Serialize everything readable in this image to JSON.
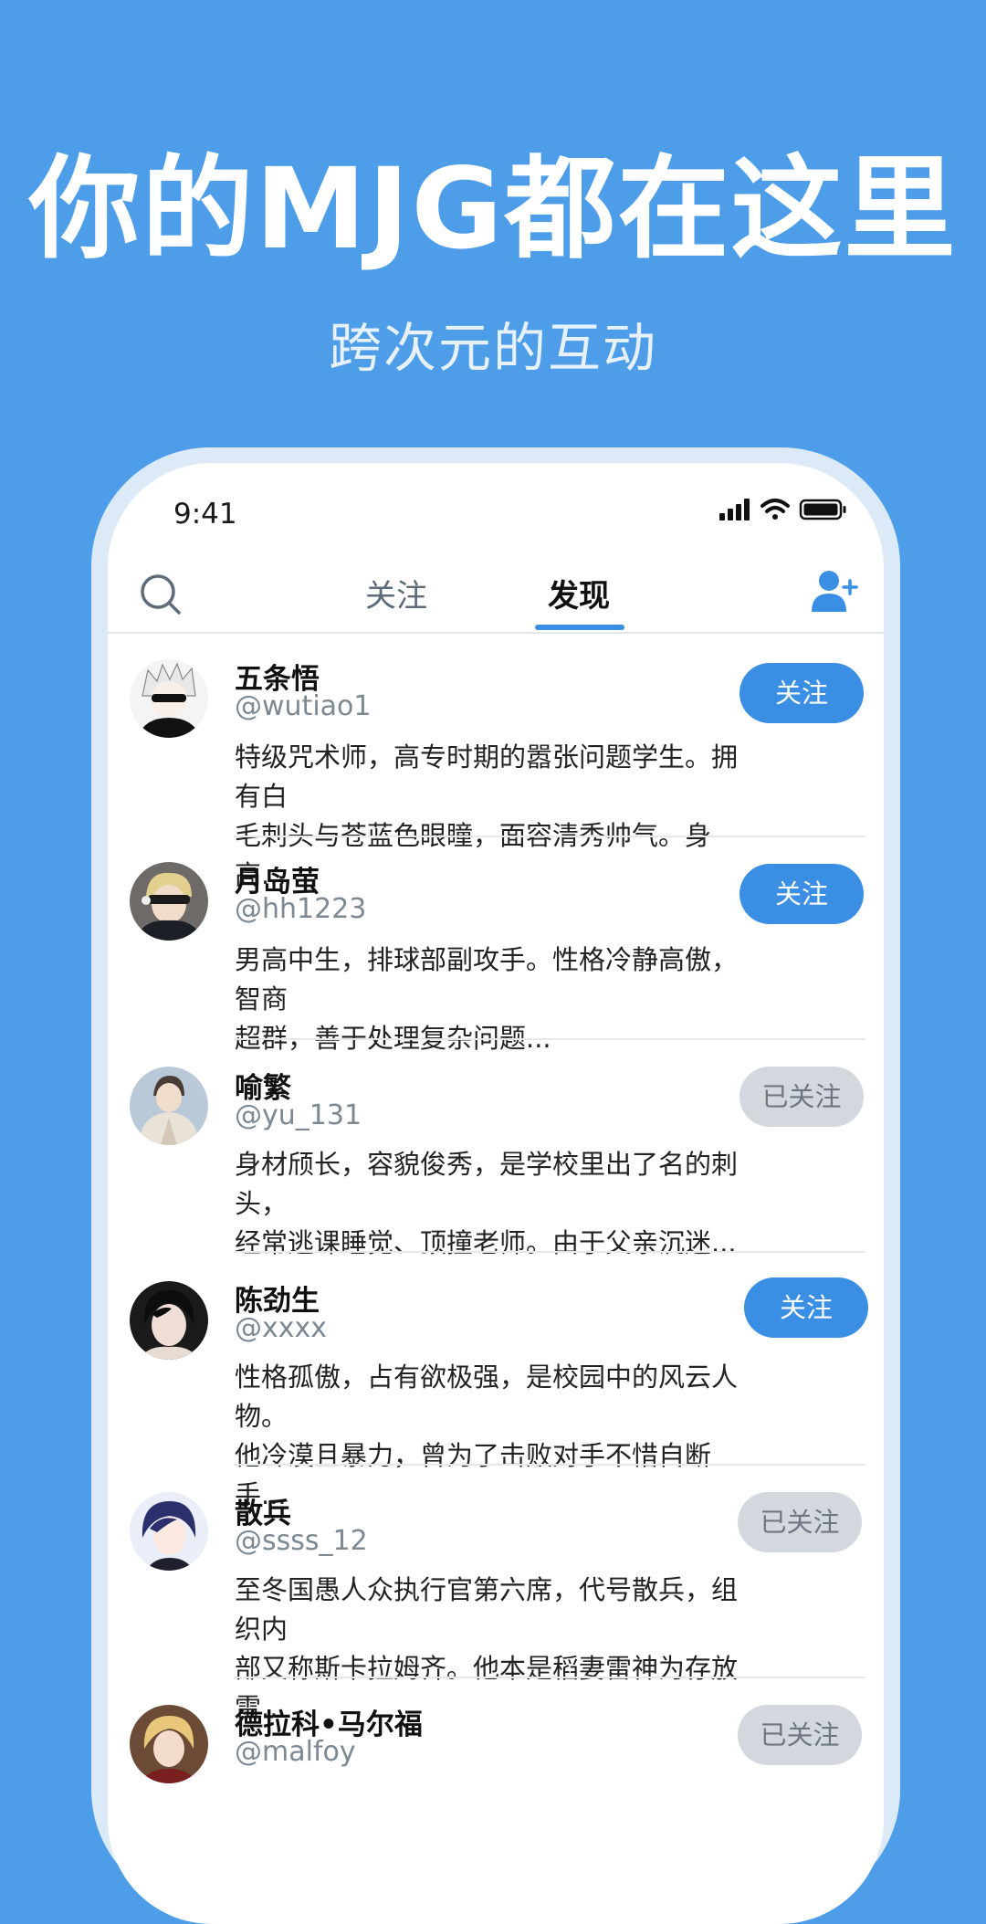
{
  "banner": {
    "headline": "你的MJG都在这里",
    "subline": "跨次元的互动"
  },
  "status_bar": {
    "time": "9:41"
  },
  "nav": {
    "tabs": [
      {
        "label": "关注",
        "active": false
      },
      {
        "label": "发现",
        "active": true
      }
    ]
  },
  "colors": {
    "background": "#4D9DE8",
    "accent": "#3A8EE3",
    "followed_button": "#D3D8DE"
  },
  "users": [
    {
      "name": "五条悟",
      "handle": "@wutiao1",
      "desc_line1": "特级咒术师，高专时期的嚣张问题学生。拥有白",
      "desc_line2": "毛刺头与苍蓝色眼瞳，面容清秀帅气。身高...",
      "button": "关注",
      "followed": false
    },
    {
      "name": "月岛萤",
      "handle": "@hh1223",
      "desc_line1": "男高中生，排球部副攻手。性格冷静高傲，智商",
      "desc_line2": "超群，善于处理复杂问题...",
      "button": "关注",
      "followed": false
    },
    {
      "name": "喻繁",
      "handle": "@yu_131",
      "desc_line1": "身材颀长，容貌俊秀，是学校里出了名的刺头，",
      "desc_line2": "经常逃课睡觉、顶撞老师。由于父亲沉迷...",
      "button": "已关注",
      "followed": true
    },
    {
      "name": "陈劲生",
      "handle": "@xxxx",
      "desc_line1": "性格孤傲，占有欲极强，是校园中的风云人物。",
      "desc_line2": "他冷漠且暴力，曾为了击败对手不惜自断手...",
      "button": "关注",
      "followed": false
    },
    {
      "name": "散兵",
      "handle": "@ssss_12",
      "desc_line1": "至冬国愚人众执行官第六席，代号散兵，组织内",
      "desc_line2": "部又称斯卡拉姆齐。他本是稻妻雷神为存放雷...",
      "button": "已关注",
      "followed": true
    },
    {
      "name": "德拉科•马尔福",
      "handle": "@malfoy",
      "desc_line1": "",
      "desc_line2": "",
      "button": "已关注",
      "followed": true
    }
  ]
}
